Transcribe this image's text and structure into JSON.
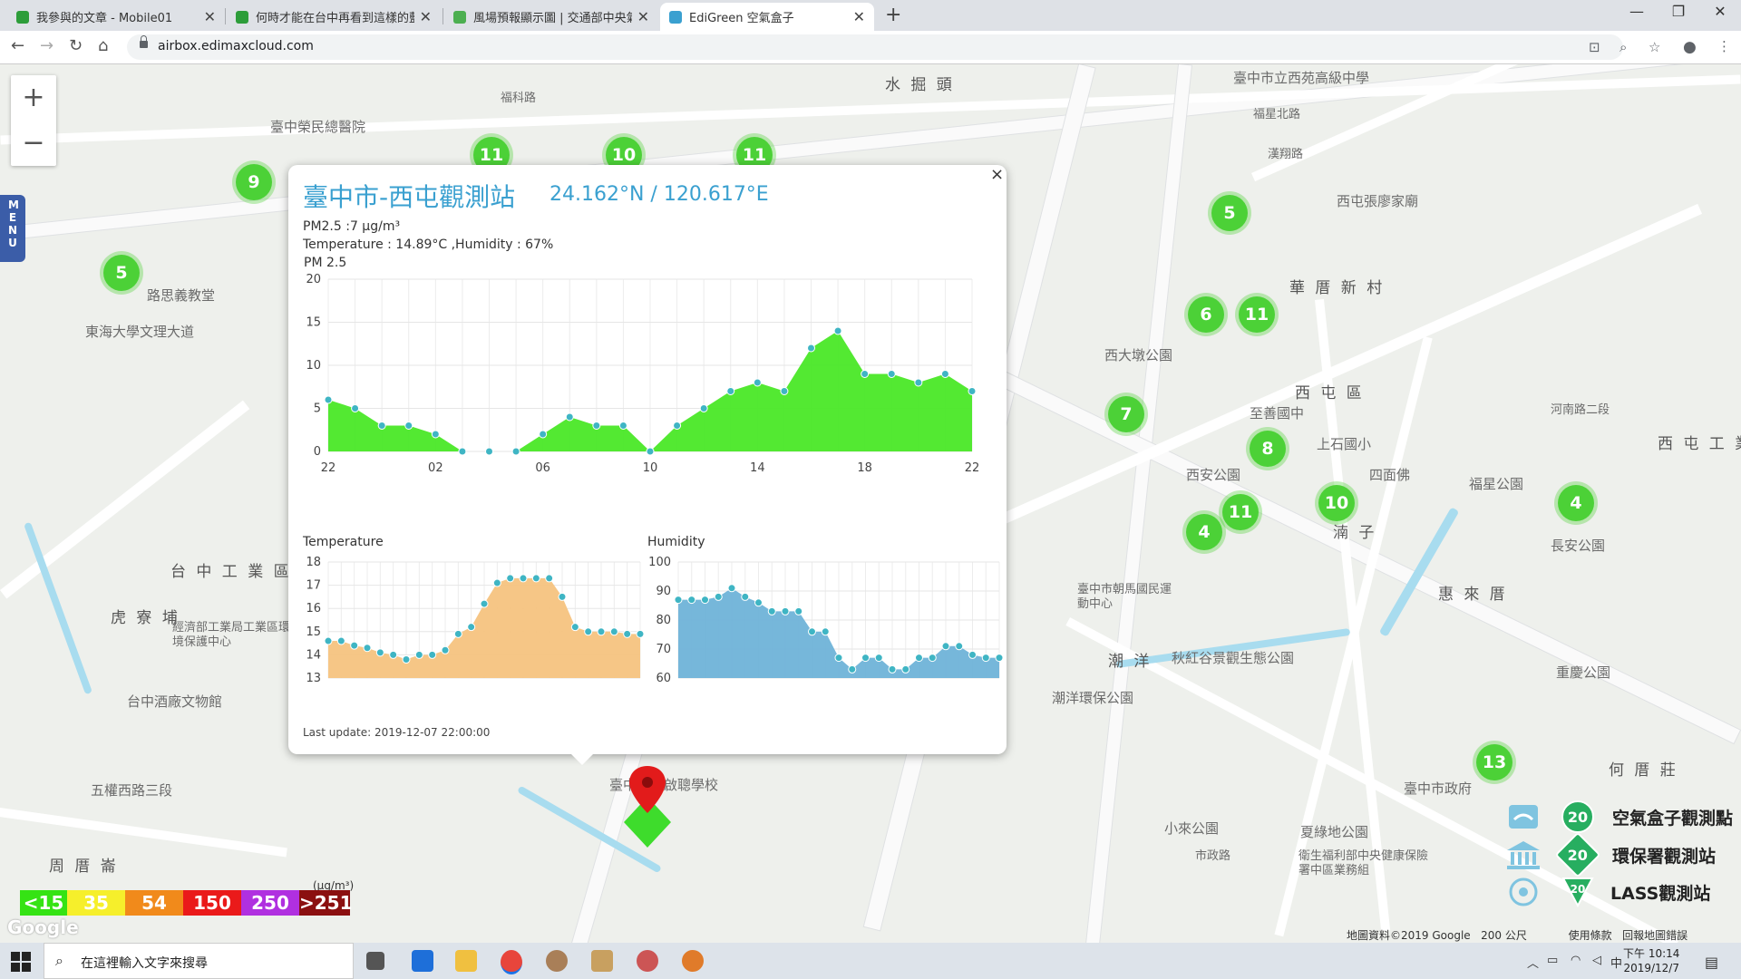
{
  "browser": {
    "tabs": [
      {
        "title": "我參與的文章 - Mobile01",
        "color": "#2d9d3a",
        "active": false
      },
      {
        "title": "何時才能在台中再看到這樣的藍天",
        "color": "#2d9d3a",
        "active": false
      },
      {
        "title": "風場預報顯示圖 | 交通部中央氣象局",
        "color": "#4caf50",
        "active": false
      },
      {
        "title": "EdiGreen 空氣盒子",
        "color": "#3aa0d0",
        "active": true
      }
    ],
    "url": "airbox.edimaxcloud.com"
  },
  "map": {
    "zoom_in": "+",
    "zoom_out": "−",
    "menu_label": "M E N U",
    "labels": [
      {
        "text": "水 掘 頭",
        "big": true
      },
      {
        "text": "臺中市立西苑高級中學"
      },
      {
        "text": "福星北路"
      },
      {
        "text": "漢翔路"
      },
      {
        "text": "福科路"
      },
      {
        "text": "臺中榮民總醫院"
      },
      {
        "text": "路思義教堂"
      },
      {
        "text": "東海大學文理大道"
      },
      {
        "text": "西屯張廖家廟"
      },
      {
        "text": "華 厝 新 村",
        "big": true
      },
      {
        "text": "西大墩公園"
      },
      {
        "text": "西 屯 區",
        "big": true
      },
      {
        "text": "至善國中"
      },
      {
        "text": "上石國小"
      },
      {
        "text": "西 屯 工 業",
        "big": true
      },
      {
        "text": "西安公園"
      },
      {
        "text": "四面佛"
      },
      {
        "text": "福星公園"
      },
      {
        "text": "湳 子",
        "big": true
      },
      {
        "text": "惠 來 厝",
        "big": true
      },
      {
        "text": "長安公園"
      },
      {
        "text": "台 中 工 業 區",
        "big": true
      },
      {
        "text": "虎 寮 埔",
        "big": true
      },
      {
        "text": "經濟部工業局工業區環境保護中心"
      },
      {
        "text": "台中酒廠文物館"
      },
      {
        "text": "臺中市朝馬國民運動中心"
      },
      {
        "text": "潮 洋",
        "big": true
      },
      {
        "text": "秋紅谷景觀生態公園"
      },
      {
        "text": "潮洋環保公園"
      },
      {
        "text": "重慶公園"
      },
      {
        "text": "何 厝 莊",
        "big": true
      },
      {
        "text": "臺中市政府"
      },
      {
        "text": "小來公園"
      },
      {
        "text": "夏綠地公園"
      },
      {
        "text": "衛生福利部中央健康保險署中區業務組"
      },
      {
        "text": "五權西路三段"
      },
      {
        "text": "周 厝 崙",
        "big": true
      },
      {
        "text": "臺中市立啟聰學校"
      },
      {
        "text": "市政路"
      },
      {
        "text": "河南路二段"
      }
    ],
    "clusters": [
      "9",
      "11",
      "10",
      "11",
      "5",
      "5",
      "6",
      "11",
      "7",
      "8",
      "10",
      "11",
      "4",
      "4",
      "13"
    ],
    "aqi_scale": {
      "unit": "(μg/m³)",
      "cells": [
        {
          "label": "<15",
          "color": "#35e314",
          "text_color": "#ffffff"
        },
        {
          "label": "35",
          "color": "#f6ef2b",
          "text_color": "#ffffff"
        },
        {
          "label": "54",
          "color": "#f18a1b",
          "text_color": "#ffffff"
        },
        {
          "label": "150",
          "color": "#ea1a1a",
          "text_color": "#ffffff"
        },
        {
          "label": "250",
          "color": "#b030e0",
          "text_color": "#ffffff"
        },
        {
          "label": ">251",
          "color": "#8b1010",
          "text_color": "#ffffff"
        }
      ]
    },
    "legend": [
      {
        "label": "空氣盒子觀測點",
        "badge": "20",
        "icon": "airbox-icon"
      },
      {
        "label": "環保署觀測站",
        "badge": "20",
        "icon": "epa-station-icon"
      },
      {
        "label": "LASS觀測站",
        "badge": "20",
        "icon": "lass-icon"
      }
    ],
    "google_logo": "Google",
    "attribution": "地圖資料©2019 Google",
    "scale_bar": "200 公尺",
    "terms": "使用條款",
    "report_error": "回報地圖錯誤"
  },
  "popup": {
    "title": "臺中市-西屯觀測站",
    "coords": "24.162°N / 120.617°E",
    "pm_line": "PM2.5 :7 μg/m³",
    "temp_humidity_line": "Temperature : 14.89°C ,Humidity : 67%",
    "chart_title": "PM 2.5",
    "last_update": "Last update: 2019-12-07 22:00:00",
    "close": "×"
  },
  "chart_data": [
    {
      "type": "area",
      "title": "PM 2.5",
      "x_tick_labels": [
        "22",
        "02",
        "06",
        "10",
        "14",
        "18",
        "22"
      ],
      "y_ticks": [
        0,
        5,
        10,
        15,
        20
      ],
      "ylim": [
        0,
        20
      ],
      "color": "#4ae827",
      "values": [
        6,
        5,
        3,
        3,
        2,
        0,
        0,
        0,
        2,
        4,
        3,
        3,
        0,
        3,
        5,
        7,
        8,
        7,
        12,
        14,
        9,
        9,
        8,
        9,
        7
      ],
      "grid": true
    },
    {
      "type": "area",
      "title": "Temperature",
      "y_ticks": [
        13,
        14,
        15,
        16,
        17,
        18
      ],
      "ylim": [
        13,
        18
      ],
      "color": "#f5c37f",
      "values": [
        14.6,
        14.6,
        14.4,
        14.3,
        14.1,
        14.0,
        13.8,
        14.0,
        14.0,
        14.2,
        14.9,
        15.2,
        16.2,
        17.1,
        17.3,
        17.3,
        17.3,
        17.3,
        16.5,
        15.2,
        15.0,
        15.0,
        15.0,
        14.9,
        14.9
      ],
      "grid": true
    },
    {
      "type": "area",
      "title": "Humidity",
      "y_ticks": [
        60,
        70,
        80,
        90,
        100
      ],
      "ylim": [
        60,
        100
      ],
      "color": "#6fb3d8",
      "values": [
        87,
        87,
        87,
        88,
        91,
        88,
        86,
        83,
        83,
        83,
        76,
        76,
        67,
        63,
        67,
        67,
        63,
        63,
        67,
        67,
        71,
        71,
        68,
        67,
        67
      ],
      "grid": true
    }
  ],
  "taskbar": {
    "search_placeholder": "在這裡輸入文字來搜尋",
    "time": "下午 10:14",
    "date": "2019/12/7",
    "ime": "中"
  }
}
